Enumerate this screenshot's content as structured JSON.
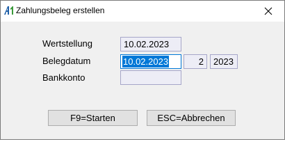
{
  "window": {
    "title": "Zahlungsbeleg erstellen"
  },
  "icons": {
    "app_logo": "app-logo-icon",
    "close": "close-icon"
  },
  "colors": {
    "field_background": "#ededf6",
    "field_border": "#a6a6c8",
    "selection": "#0078d7"
  },
  "form": {
    "wertstellung": {
      "label": "Wertstellung",
      "value": "10.02.2023"
    },
    "belegdatum": {
      "label": "Belegdatum",
      "value": "10.02.2023",
      "period": "2",
      "year": "2023"
    },
    "bankkonto": {
      "label": "Bankkonto",
      "value": ""
    }
  },
  "buttons": {
    "start": "F9=Starten",
    "cancel": "ESC=Abbrechen"
  }
}
